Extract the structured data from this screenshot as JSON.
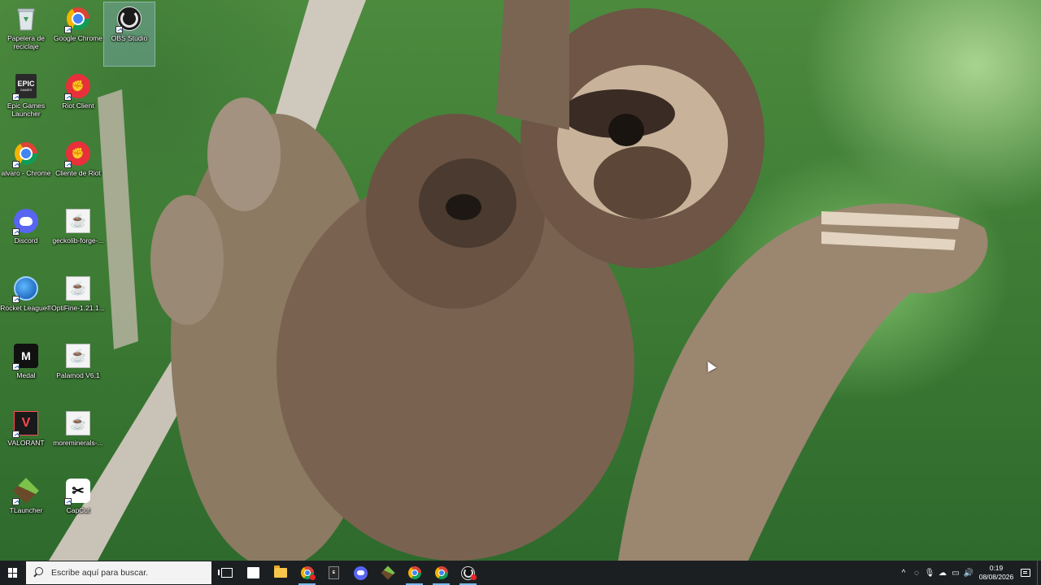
{
  "desktop": {
    "icons": [
      {
        "label": "Papelera de reciclaje",
        "icon": "recycle-bin-icon"
      },
      {
        "label": "Google Chrome",
        "icon": "chrome-icon"
      },
      {
        "label": "OBS Studio",
        "icon": "obs-icon",
        "selected": true
      },
      {
        "label": "Epic Games Launcher",
        "icon": "epic-games-icon",
        "glyph_text": "EPIC",
        "glyph_sub": "GAMES"
      },
      {
        "label": "Riot Client",
        "icon": "riot-icon"
      },
      {
        "label": "alvaro - Chrome",
        "icon": "chrome-profile-icon"
      },
      {
        "label": "Cliente de Riot",
        "icon": "riot-icon"
      },
      {
        "label": "Discord",
        "icon": "discord-icon"
      },
      {
        "label": "geckolib-forge-...",
        "icon": "java-icon"
      },
      {
        "label": "Rocket League®",
        "icon": "rocket-league-icon"
      },
      {
        "label": "OptiFine-1.21.1...",
        "icon": "java-icon"
      },
      {
        "label": "Medal",
        "icon": "medal-icon"
      },
      {
        "label": "Palamod V6.1",
        "icon": "java-icon"
      },
      {
        "label": "VALORANT",
        "icon": "valorant-icon"
      },
      {
        "label": "moreminerals-...",
        "icon": "java-icon"
      },
      {
        "label": "TLauncher",
        "icon": "tlauncher-icon"
      },
      {
        "label": "CapCut",
        "icon": "capcut-icon"
      }
    ]
  },
  "taskbar": {
    "search_placeholder": "Escribe aquí para buscar.",
    "pinned": [
      "task-view-icon",
      "store-icon",
      "file-explorer-icon",
      "chrome-icon",
      "epic-games-icon",
      "discord-icon",
      "tlauncher-icon",
      "chrome-icon",
      "chrome-icon",
      "obs-icon"
    ],
    "tray": {
      "time": "0:19",
      "date": "08/08/2026"
    }
  },
  "colors": {
    "taskbar_bg": "#1c1f22",
    "selection": "#a0c8ff",
    "accent_underline": "#76b9ed"
  }
}
